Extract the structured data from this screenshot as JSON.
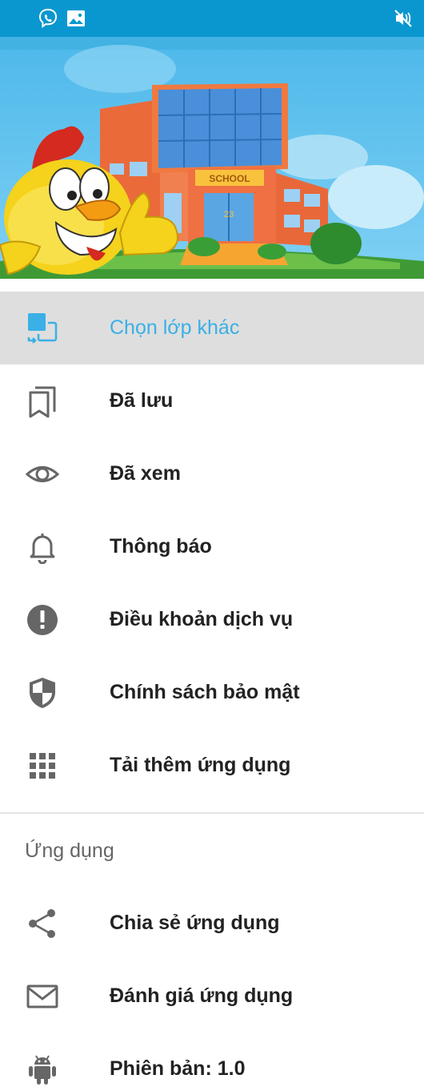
{
  "status_bar": {
    "icons": [
      "viber-icon",
      "image-icon",
      "mute-icon"
    ],
    "color": "#0a97cf"
  },
  "header": {
    "banner_text": "SCHOOL",
    "banner_number": "23"
  },
  "menu": {
    "items": [
      {
        "label": "Chọn lớp khác",
        "icon": "switch-class-icon",
        "active": true
      },
      {
        "label": "Đã lưu",
        "icon": "bookmarks-icon"
      },
      {
        "label": "Đã xem",
        "icon": "eye-icon"
      },
      {
        "label": "Thông báo",
        "icon": "bell-icon"
      },
      {
        "label": "Điều khoản dịch vụ",
        "icon": "alert-circle-icon"
      },
      {
        "label": "Chính sách bảo mật",
        "icon": "shield-icon"
      },
      {
        "label": "Tải thêm ứng dụng",
        "icon": "apps-grid-icon"
      }
    ]
  },
  "section": {
    "title": "Ứng dụng",
    "items": [
      {
        "label": "Chia sẻ ứng dụng",
        "icon": "share-icon"
      },
      {
        "label": "Đánh giá ứng dụng",
        "icon": "mail-icon"
      },
      {
        "label": "Phiên bản: 1.0",
        "icon": "android-icon"
      }
    ]
  },
  "colors": {
    "accent": "#3ab0e6",
    "active_bg": "#dedede",
    "icon_gray": "#666666"
  }
}
